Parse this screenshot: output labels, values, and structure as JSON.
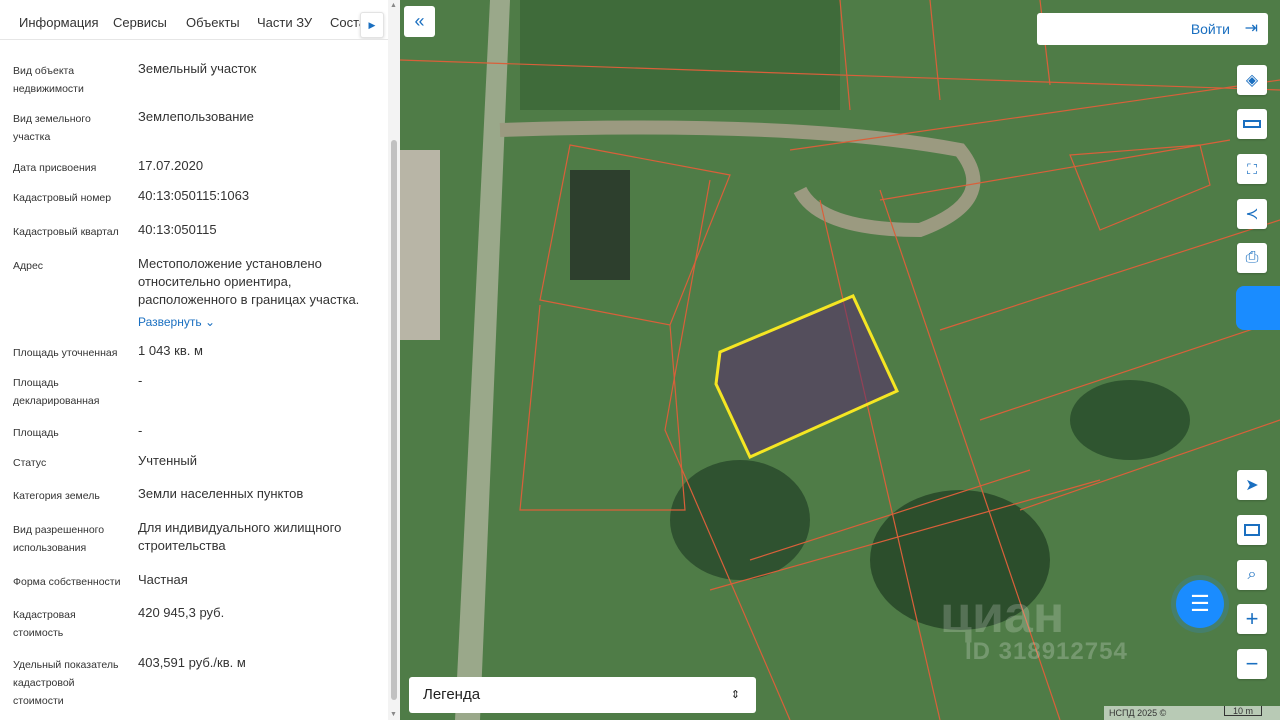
{
  "tabs": [
    "Информация",
    "Сервисы",
    "Объекты",
    "Части ЗУ",
    "Состав"
  ],
  "rows": [
    {
      "label": "Вид объекта недвижимости",
      "value": "Земельный участок"
    },
    {
      "label": "Вид земельного участка",
      "value": "Землепользование"
    },
    {
      "label": "Дата присвоения",
      "value": "17.07.2020"
    },
    {
      "label": "Кадастровый номер",
      "value": "40:13:050115:1063"
    },
    {
      "label": "Кадастровый квартал",
      "value": "40:13:050115"
    },
    {
      "label": "Адрес",
      "value": "Местоположение установлено относительно ориентира, расположенного в границах участка.",
      "more": "Развернуть"
    },
    {
      "label": "Площадь уточненная",
      "value": "1 043 кв. м"
    },
    {
      "label": "Площадь декларированная",
      "value": "-"
    },
    {
      "label": "Площадь",
      "value": "-"
    },
    {
      "label": "Статус",
      "value": "Учтенный"
    },
    {
      "label": "Категория земель",
      "value": "Земли населенных пунктов"
    },
    {
      "label": "Вид разрешенного использования",
      "value": "Для индивидуального жилищного строительства"
    },
    {
      "label": "Форма собственности",
      "value": "Частная"
    },
    {
      "label": "Кадастровая стоимость",
      "value": "420 945,3 руб."
    },
    {
      "label": "Удельный показатель кадастровой стоимости",
      "value": "403,591 руб./кв. м"
    }
  ],
  "map": {
    "login": "Войти",
    "legend": "Легенда",
    "attribution": "НСПД 2025 ©",
    "scale": "10 m",
    "watermark": "циан",
    "watermark_id": "ID 318912754",
    "accent": "#1a8cff",
    "highlight": "#f5e623"
  }
}
